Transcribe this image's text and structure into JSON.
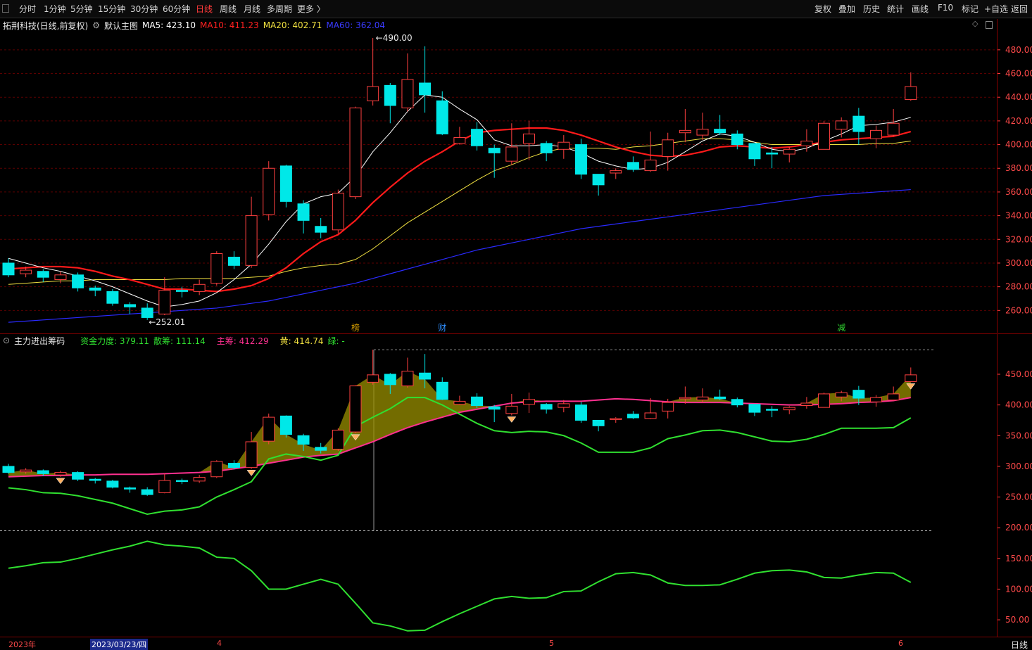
{
  "toolbar": {
    "periods": [
      "分时",
      "1分钟",
      "5分钟",
      "15分钟",
      "30分钟",
      "60分钟",
      "日线",
      "周线",
      "月线",
      "多周期",
      "更多 〉"
    ],
    "active_period": "日线",
    "right_items": [
      "复权",
      "叠加",
      "历史",
      "统计",
      "画线",
      "F10",
      "标记",
      "+自选",
      "返回"
    ]
  },
  "main_legend": {
    "stock": "拓荆科技(日线,前复权)",
    "template": "默认主图",
    "ma5": "MA5: 423.10",
    "ma10": "MA10: 411.23",
    "ma20": "MA20: 402.71",
    "ma60": "MA60: 362.04",
    "colors": {
      "ma5": "#ffffff",
      "ma10": "#ff2020",
      "ma20": "#f0e040",
      "ma60": "#2a2aff"
    }
  },
  "main_annotations": {
    "high": "490.00",
    "low": "252.01"
  },
  "event_markers": [
    {
      "label": "榜",
      "color": "#d8a000"
    },
    {
      "label": "财",
      "color": "#2f8fff"
    },
    {
      "label": "减",
      "color": "#30d030"
    }
  ],
  "indicator_legend": {
    "name": "主力进出筹码",
    "fund": "资金力度: 379.11",
    "scatter": "散筹: 111.14",
    "main": "主筹: 412.29",
    "yellow": "黄: 414.74",
    "green": "绿: -",
    "colors": {
      "fund": "#30e030",
      "scatter": "#30e030",
      "main": "#ff3090",
      "yellow": "#f0e040",
      "green": "#30e030"
    }
  },
  "main_axis_ticks": [
    "480.00",
    "460.00",
    "440.00",
    "420.00",
    "400.00",
    "380.00",
    "360.00",
    "340.00",
    "320.00",
    "300.00",
    "280.00",
    "260.00"
  ],
  "ind_axis_ticks": [
    "450.00",
    "400.00",
    "350.00",
    "300.00",
    "250.00",
    "200.00",
    "150.00",
    "100.00",
    "50.00"
  ],
  "x_axis": {
    "labels": [
      "2023年",
      "2023/03/23/四",
      "4",
      "5",
      "6"
    ],
    "period_label": "日线"
  },
  "chart_data": {
    "type": "candlestick",
    "title": "拓荆科技(日线,前复权)",
    "ylim": [
      245,
      495
    ],
    "candles": [
      {
        "o": 300,
        "c": 290,
        "h": 304,
        "l": 288
      },
      {
        "o": 291,
        "c": 294,
        "h": 297,
        "l": 288
      },
      {
        "o": 293,
        "c": 288,
        "h": 295,
        "l": 284
      },
      {
        "o": 286,
        "c": 290,
        "h": 293,
        "l": 283
      },
      {
        "o": 290,
        "c": 279,
        "h": 292,
        "l": 276
      },
      {
        "o": 279,
        "c": 277,
        "h": 281,
        "l": 272
      },
      {
        "o": 276,
        "c": 266,
        "h": 278,
        "l": 264
      },
      {
        "o": 265,
        "c": 263,
        "h": 267,
        "l": 257
      },
      {
        "o": 262,
        "c": 254,
        "h": 266,
        "l": 252
      },
      {
        "o": 257,
        "c": 277,
        "h": 288,
        "l": 256
      },
      {
        "o": 277,
        "c": 276,
        "h": 280,
        "l": 271
      },
      {
        "o": 276,
        "c": 282,
        "h": 286,
        "l": 273
      },
      {
        "o": 283,
        "c": 308,
        "h": 310,
        "l": 281
      },
      {
        "o": 305,
        "c": 298,
        "h": 310,
        "l": 295
      },
      {
        "o": 298,
        "c": 340,
        "h": 356,
        "l": 296
      },
      {
        "o": 341,
        "c": 380,
        "h": 386,
        "l": 336
      },
      {
        "o": 382,
        "c": 352,
        "h": 383,
        "l": 347
      },
      {
        "o": 350,
        "c": 336,
        "h": 353,
        "l": 325
      },
      {
        "o": 331,
        "c": 326,
        "h": 338,
        "l": 321
      },
      {
        "o": 328,
        "c": 359,
        "h": 362,
        "l": 325
      },
      {
        "o": 356,
        "c": 431,
        "h": 432,
        "l": 354
      },
      {
        "o": 437,
        "c": 449,
        "h": 490,
        "l": 433
      },
      {
        "o": 450,
        "c": 433,
        "h": 452,
        "l": 418
      },
      {
        "o": 431,
        "c": 455,
        "h": 477,
        "l": 428
      },
      {
        "o": 452,
        "c": 442,
        "h": 483,
        "l": 427
      },
      {
        "o": 437,
        "c": 409,
        "h": 445,
        "l": 408
      },
      {
        "o": 401,
        "c": 406,
        "h": 415,
        "l": 400
      },
      {
        "o": 413,
        "c": 399,
        "h": 419,
        "l": 395
      },
      {
        "o": 397,
        "c": 393,
        "h": 400,
        "l": 372
      },
      {
        "o": 386,
        "c": 398,
        "h": 418,
        "l": 383
      },
      {
        "o": 401,
        "c": 409,
        "h": 420,
        "l": 387
      },
      {
        "o": 401,
        "c": 393,
        "h": 403,
        "l": 386
      },
      {
        "o": 396,
        "c": 402,
        "h": 408,
        "l": 388
      },
      {
        "o": 400,
        "c": 375,
        "h": 405,
        "l": 371
      },
      {
        "o": 375,
        "c": 366,
        "h": 375,
        "l": 357
      },
      {
        "o": 376,
        "c": 378,
        "h": 380,
        "l": 371
      },
      {
        "o": 385,
        "c": 379,
        "h": 390,
        "l": 377
      },
      {
        "o": 378,
        "c": 387,
        "h": 411,
        "l": 377
      },
      {
        "o": 390,
        "c": 404,
        "h": 410,
        "l": 378
      },
      {
        "o": 410,
        "c": 412,
        "h": 430,
        "l": 402
      },
      {
        "o": 408,
        "c": 413,
        "h": 427,
        "l": 404
      },
      {
        "o": 413,
        "c": 410,
        "h": 425,
        "l": 408
      },
      {
        "o": 409,
        "c": 400,
        "h": 412,
        "l": 396
      },
      {
        "o": 401,
        "c": 388,
        "h": 401,
        "l": 382
      },
      {
        "o": 393,
        "c": 392,
        "h": 398,
        "l": 380
      },
      {
        "o": 392,
        "c": 396,
        "h": 398,
        "l": 385
      },
      {
        "o": 399,
        "c": 403,
        "h": 413,
        "l": 394
      },
      {
        "o": 396,
        "c": 418,
        "h": 420,
        "l": 396
      },
      {
        "o": 413,
        "c": 420,
        "h": 423,
        "l": 406
      },
      {
        "o": 424,
        "c": 411,
        "h": 431,
        "l": 400
      },
      {
        "o": 405,
        "c": 412,
        "h": 416,
        "l": 397
      },
      {
        "o": 408,
        "c": 418,
        "h": 430,
        "l": 407
      },
      {
        "o": 438,
        "c": 449,
        "h": 461,
        "l": 437
      }
    ],
    "ma5": [
      304,
      300,
      296,
      293,
      289,
      285,
      280,
      274,
      268,
      263,
      265,
      268,
      275,
      286,
      299,
      316,
      335,
      350,
      356,
      359,
      373,
      394,
      410,
      428,
      442,
      440,
      430,
      421,
      404,
      399,
      399,
      400,
      398,
      393,
      386,
      382,
      379,
      380,
      385,
      394,
      403,
      409,
      407,
      402,
      396,
      394,
      397,
      403,
      409,
      416,
      417,
      419,
      423
    ],
    "ma10": [
      295,
      296,
      297,
      297,
      296,
      293,
      289,
      286,
      282,
      278,
      278,
      277,
      276,
      278,
      281,
      287,
      296,
      308,
      318,
      324,
      336,
      351,
      364,
      376,
      386,
      394,
      403,
      410,
      412,
      413,
      414,
      414,
      412,
      408,
      403,
      398,
      394,
      391,
      390,
      391,
      394,
      398,
      399,
      398,
      397,
      398,
      400,
      402,
      404,
      405,
      406,
      407,
      411
    ],
    "ma20": [
      282,
      283,
      284,
      285,
      285,
      286,
      286,
      286,
      286,
      286,
      287,
      287,
      287,
      287,
      288,
      289,
      293,
      296,
      298,
      299,
      303,
      312,
      323,
      334,
      343,
      352,
      361,
      370,
      378,
      383,
      389,
      394,
      397,
      397,
      397,
      396,
      398,
      399,
      401,
      403,
      405,
      405,
      404,
      402,
      400,
      400,
      400,
      400,
      400,
      400,
      401,
      401,
      403
    ],
    "ma60": [
      250,
      251,
      252,
      253,
      254,
      255,
      256,
      257,
      258,
      259,
      260,
      261,
      262,
      264,
      266,
      268,
      271,
      274,
      277,
      280,
      283,
      287,
      291,
      295,
      299,
      303,
      307,
      311,
      314,
      317,
      320,
      323,
      326,
      329,
      331,
      333,
      335,
      337,
      339,
      341,
      343,
      345,
      347,
      349,
      351,
      353,
      355,
      357,
      358,
      359,
      360,
      361,
      362
    ],
    "indicator": {
      "ylim": [
        30,
        500
      ],
      "main_chips": [
        283,
        284,
        285,
        285,
        286,
        286,
        287,
        287,
        287,
        288,
        289,
        290,
        292,
        296,
        300,
        305,
        310,
        315,
        318,
        320,
        330,
        340,
        352,
        363,
        372,
        380,
        388,
        393,
        398,
        403,
        405,
        406,
        406,
        406,
        408,
        410,
        409,
        407,
        405,
        404,
        404,
        404,
        403,
        402,
        401,
        400,
        400,
        401,
        402,
        404,
        405,
        407,
        412
      ],
      "fund_strength": [
        265,
        262,
        257,
        256,
        252,
        246,
        240,
        231,
        222,
        227,
        229,
        234,
        250,
        262,
        275,
        312,
        320,
        316,
        310,
        318,
        365,
        380,
        394,
        412,
        412,
        400,
        385,
        370,
        358,
        355,
        357,
        356,
        350,
        338,
        323,
        323,
        323,
        330,
        345,
        351,
        358,
        359,
        355,
        348,
        341,
        340,
        344,
        352,
        362,
        362,
        362,
        363,
        379
      ],
      "scatter_chips": [
        134,
        138,
        143,
        144,
        150,
        157,
        164,
        170,
        178,
        172,
        170,
        167,
        152,
        150,
        130,
        100,
        100,
        108,
        116,
        108,
        77,
        45,
        40,
        32,
        33,
        47,
        60,
        72,
        84,
        88,
        85,
        86,
        96,
        97,
        112,
        125,
        127,
        123,
        110,
        106,
        106,
        107,
        116,
        126,
        130,
        131,
        128,
        119,
        118,
        123,
        127,
        126,
        111
      ]
    }
  }
}
